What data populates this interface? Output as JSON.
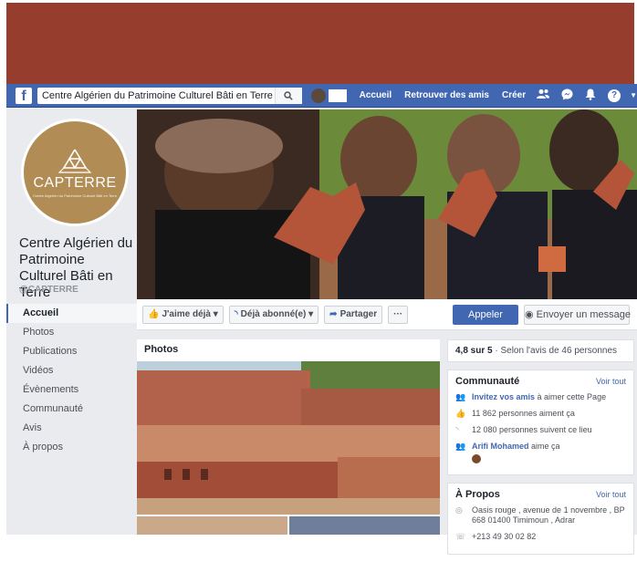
{
  "topbar": {
    "logo": "f",
    "search_value": "Centre Algérien du Patrimoine Culturel Bâti en Terre",
    "search_icon": "search-icon",
    "links": [
      "Accueil",
      "Retrouver des amis",
      "Créer"
    ],
    "help": "?"
  },
  "profile": {
    "logo_word": "CAPTERRE",
    "logo_sub": "Centre Algérien du Patrimoine Culturel Bâti en Terre",
    "name": "Centre Algérien du Patrimoine Culturel Bâti en Terre",
    "handle": "@CAPTERRE"
  },
  "nav": [
    "Accueil",
    "Photos",
    "Publications",
    "Vidéos",
    "Évènements",
    "Communauté",
    "Avis",
    "À propos"
  ],
  "actions": {
    "like": "J'aime déjà",
    "follow": "Déjà abonné(e)",
    "share": "Partager",
    "more": "···",
    "call": "Appeler",
    "message": "Envoyer un message"
  },
  "photos": {
    "title": "Photos"
  },
  "rating": {
    "score": "4,8 sur 5",
    "text": " · Selon l'avis de 46 personnes"
  },
  "community": {
    "title": "Communauté",
    "see_all": "Voir tout",
    "invite_link": "Invitez vos amis",
    "invite_text": " à aimer cette Page",
    "likes": "11 862 personnes aiment ça",
    "follows": "12 080 personnes suivent ce lieu",
    "friend_name": "Arifi Mohamed",
    "friend_text": " aime ça"
  },
  "about": {
    "title": "À Propos",
    "see_all": "Voir tout",
    "address": "Oasis rouge , avenue de 1 novembre , BP 668 01400 Timimoun , Adrar",
    "phone": "+213 49 30 02 82"
  },
  "colors": {
    "banner": "#973d2e",
    "fb_blue": "#4267b2",
    "logo_gold": "#b18d55"
  }
}
